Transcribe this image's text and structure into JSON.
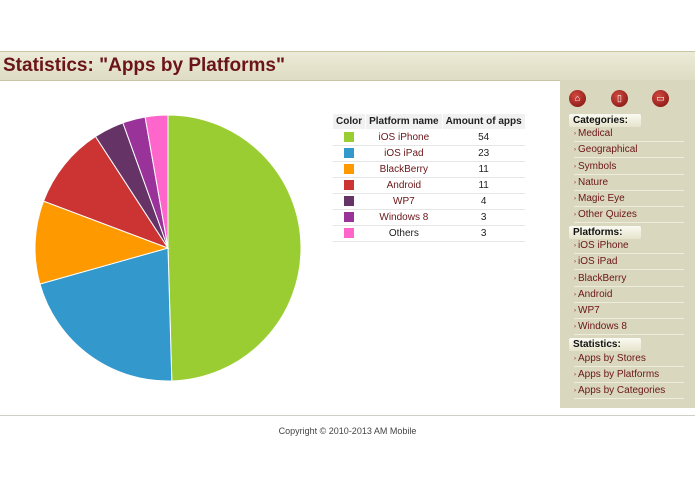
{
  "header": {
    "title": "Statistics: \"Apps by Platforms\""
  },
  "table": {
    "headers": [
      "Color",
      "Platform name",
      "Amount of apps"
    ],
    "rows": [
      {
        "color": "#9acd32",
        "name": "iOS iPhone",
        "amount": "54"
      },
      {
        "color": "#3399cc",
        "name": "iOS iPad",
        "amount": "23"
      },
      {
        "color": "#ff9900",
        "name": "BlackBerry",
        "amount": "11"
      },
      {
        "color": "#cc3333",
        "name": "Android",
        "amount": "11"
      },
      {
        "color": "#663366",
        "name": "WP7",
        "amount": "4"
      },
      {
        "color": "#993399",
        "name": "Windows 8",
        "amount": "3"
      },
      {
        "color": "#ff66cc",
        "name": "Others",
        "amount": "3"
      }
    ]
  },
  "chart_data": {
    "type": "pie",
    "categories": [
      "iOS iPhone",
      "iOS iPad",
      "BlackBerry",
      "Android",
      "WP7",
      "Windows 8",
      "Others"
    ],
    "values": [
      54,
      23,
      11,
      11,
      4,
      3,
      3
    ],
    "colors": [
      "#9acd32",
      "#3399cc",
      "#ff9900",
      "#cc3333",
      "#663366",
      "#993399",
      "#ff66cc"
    ]
  },
  "sidebar": {
    "top_icons": [
      "home-icon",
      "phone-icon",
      "tablet-icon"
    ],
    "categories_title": "Categories:",
    "categories": [
      "Medical",
      "Geographical",
      "Symbols",
      "Nature",
      "Magic Eye",
      "Other Quizes"
    ],
    "platforms_title": "Platforms:",
    "platforms": [
      "iOS iPhone",
      "iOS iPad",
      "BlackBerry",
      "Android",
      "WP7",
      "Windows 8"
    ],
    "statistics_title": "Statistics:",
    "statistics": [
      "Apps by Stores",
      "Apps by Platforms",
      "Apps by Categories"
    ]
  },
  "footer": {
    "copyright": "Copyright © 2010-2013 AM Mobile"
  }
}
